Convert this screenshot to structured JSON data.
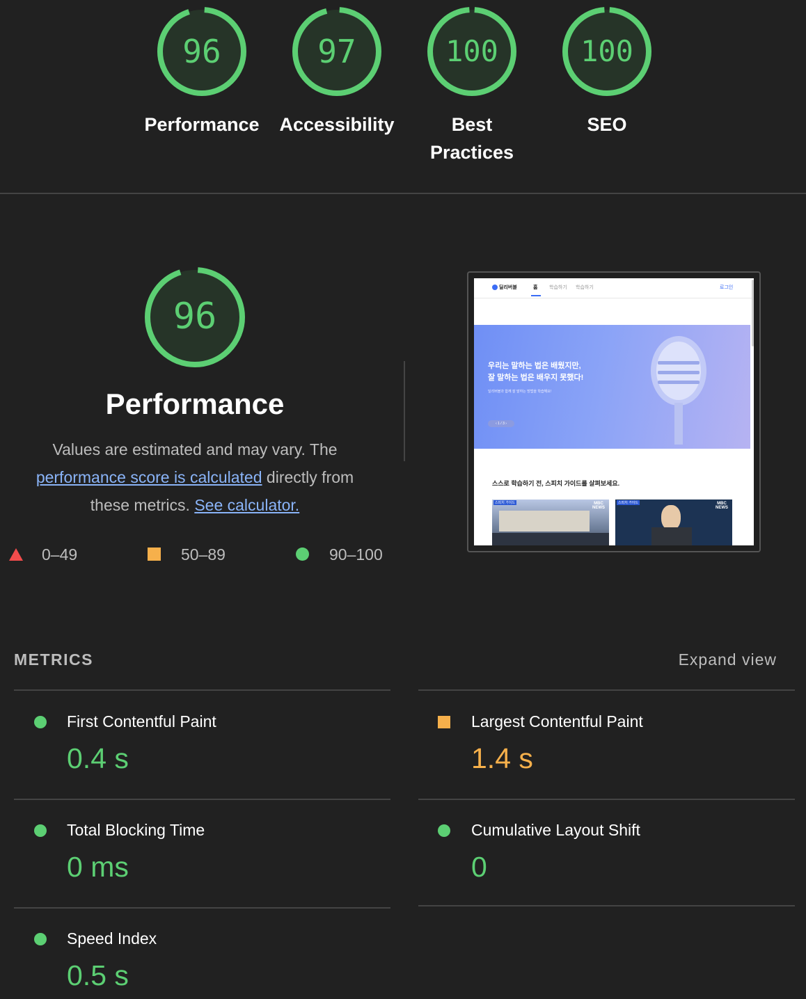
{
  "scores": [
    {
      "value": "96",
      "label_lines": [
        "Performance"
      ],
      "fraction": 0.96
    },
    {
      "value": "97",
      "label_lines": [
        "Accessibility"
      ],
      "fraction": 0.97
    },
    {
      "value": "100",
      "label_lines": [
        "Best",
        "Practices"
      ],
      "fraction": 1.0
    },
    {
      "value": "100",
      "label_lines": [
        "SEO"
      ],
      "fraction": 1.0
    }
  ],
  "performance": {
    "score": "96",
    "score_fraction": 0.96,
    "title": "Performance",
    "desc_1": "Values are estimated and may vary. The",
    "link_1": "performance score is calculated",
    "desc_2": " directly from",
    "desc_3": "these metrics. ",
    "link_2": "See calculator."
  },
  "legend": {
    "fail": "0–49",
    "average": "50–89",
    "pass": "90–100"
  },
  "thumbnail": {
    "brand": "딜리버블",
    "nav_home": "홈",
    "nav_2": "학습하기",
    "nav_3": "학습하기",
    "login": "로그인",
    "hero_line1": "우리는 말하는 법은 배웠지만,",
    "hero_line2": "잘 말하는 법은 배우지 못했다!",
    "hero_sub": "딜리버블과 함께 잘 말하는 방법을 학습해요!",
    "pager": "‹ 1 / 3 ›",
    "section_caption": "스스로 학습하기 전, 스피치 가이드를 살펴보세요.",
    "card_badge": "스피치 가이드",
    "card_logo": "MBC NEWS"
  },
  "metrics": {
    "heading": "METRICS",
    "expand": "Expand view",
    "items": [
      {
        "name": "First Contentful Paint",
        "value": "0.4 s",
        "status": "pass"
      },
      {
        "name": "Largest Contentful Paint",
        "value": "1.4 s",
        "status": "average"
      },
      {
        "name": "Total Blocking Time",
        "value": "0 ms",
        "status": "pass"
      },
      {
        "name": "Cumulative Layout Shift",
        "value": "0",
        "status": "pass"
      },
      {
        "name": "Speed Index",
        "value": "0.5 s",
        "status": "pass"
      }
    ]
  },
  "colors": {
    "pass": "#5ccf73",
    "average": "#f6b04b",
    "fail": "#f24c4c"
  }
}
